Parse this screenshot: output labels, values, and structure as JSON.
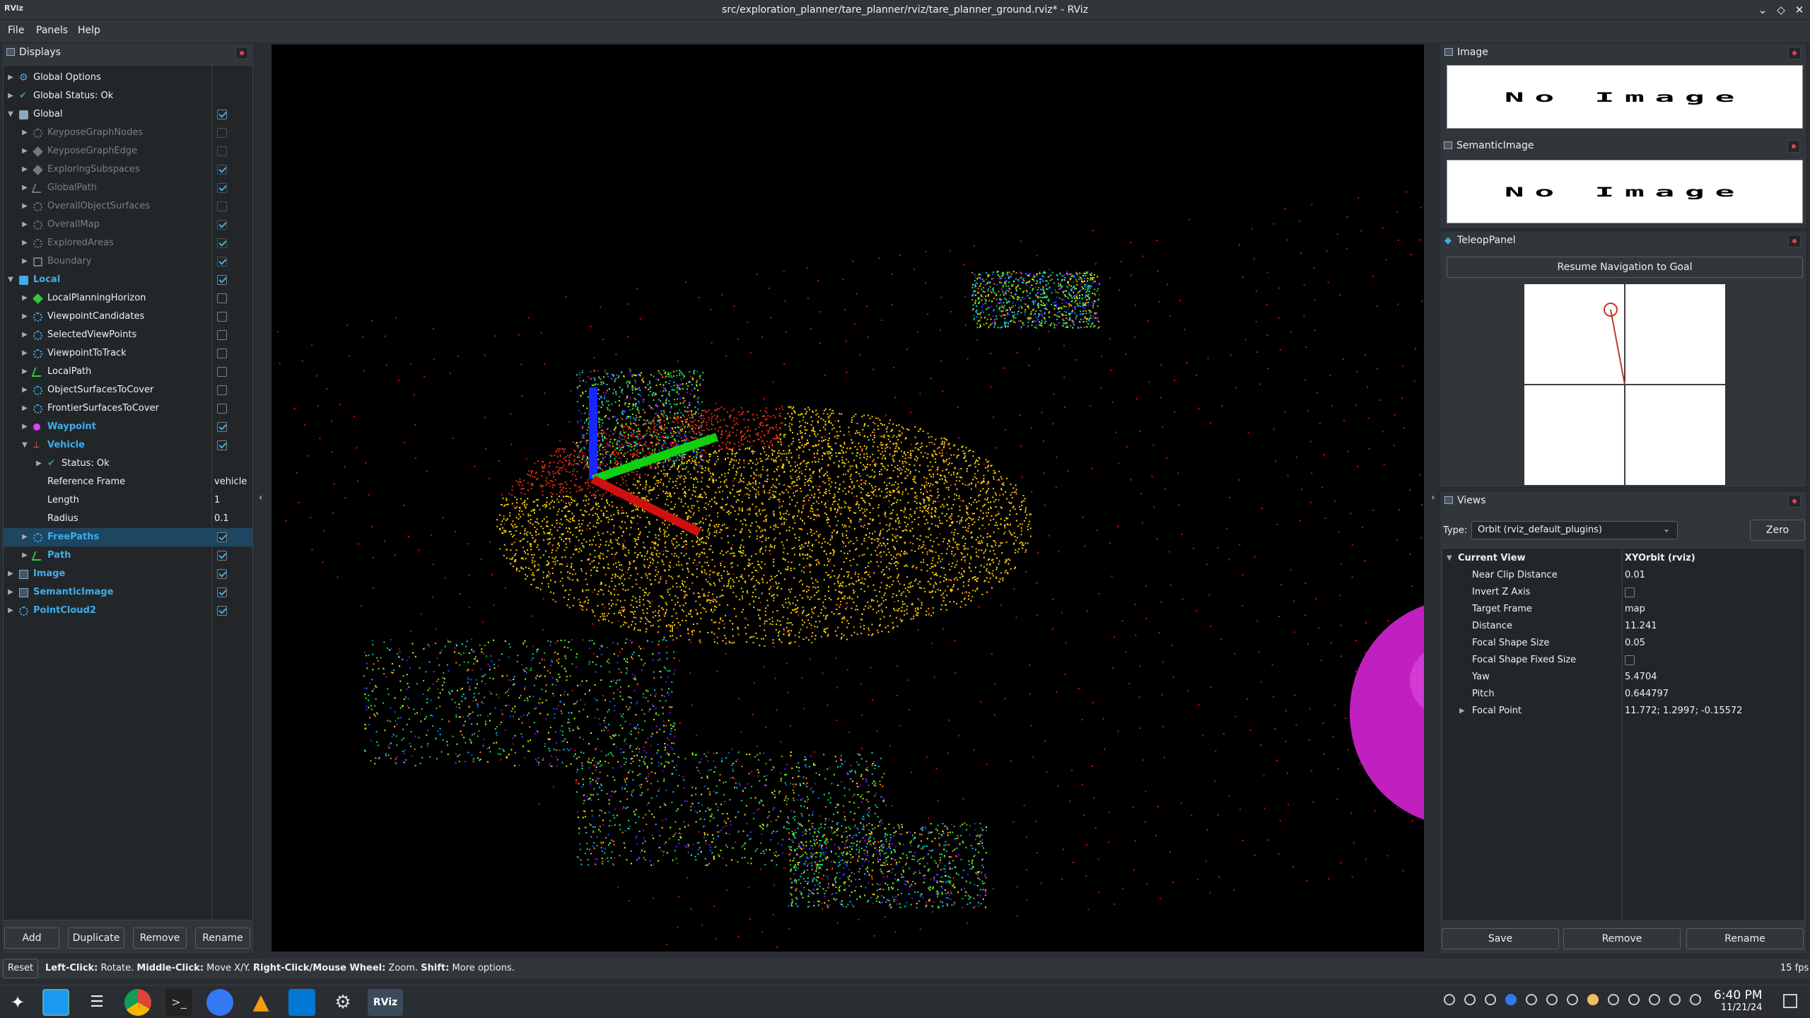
{
  "window": {
    "app_icon": "RViz",
    "title": "src/exploration_planner/tare_planner/rviz/tare_planner_ground.rviz* - RViz"
  },
  "menubar": [
    "File",
    "Panels",
    "Help"
  ],
  "displays_panel": {
    "title": "Displays",
    "items": [
      {
        "label": "Global Options"
      },
      {
        "label": "Global Status: Ok"
      },
      {
        "label": "Global"
      },
      {
        "label": "KeyposeGraphNodes"
      },
      {
        "label": "KeyposeGraphEdge"
      },
      {
        "label": "ExploringSubspaces"
      },
      {
        "label": "GlobalPath"
      },
      {
        "label": "OverallObjectSurfaces"
      },
      {
        "label": "OverallMap"
      },
      {
        "label": "ExploredAreas"
      },
      {
        "label": "Boundary"
      },
      {
        "label": "Local"
      },
      {
        "label": "LocalPlanningHorizon"
      },
      {
        "label": "ViewpointCandidates"
      },
      {
        "label": "SelectedViewPoints"
      },
      {
        "label": "ViewpointToTrack"
      },
      {
        "label": "LocalPath"
      },
      {
        "label": "ObjectSurfacesToCover"
      },
      {
        "label": "FrontierSurfacesToCover"
      },
      {
        "label": "Waypoint"
      },
      {
        "label": "Vehicle"
      },
      {
        "label": "Status: Ok"
      },
      {
        "label": "Reference Frame",
        "value": "vehicle"
      },
      {
        "label": "Length",
        "value": "1"
      },
      {
        "label": "Radius",
        "value": "0.1"
      },
      {
        "label": "FreePaths"
      },
      {
        "label": "Path"
      },
      {
        "label": "Image"
      },
      {
        "label": "SemanticImage"
      },
      {
        "label": "PointCloud2"
      }
    ],
    "buttons": [
      "Add",
      "Duplicate",
      "Remove",
      "Rename"
    ]
  },
  "image_panel": {
    "title": "Image",
    "content": "No Image"
  },
  "semantic_image_panel": {
    "title": "SemanticImage",
    "content": "No Image"
  },
  "teleop_panel": {
    "title": "TeleopPanel",
    "button": "Resume Navigation to Goal"
  },
  "views_panel": {
    "title": "Views",
    "type_label": "Type:",
    "type_value": "Orbit (rviz_default_plugins)",
    "zero_button": "Zero",
    "current_view": {
      "label": "Current View",
      "value": "XYOrbit (rviz)"
    },
    "properties": [
      {
        "label": "Near Clip Distance",
        "value": "0.01"
      },
      {
        "label": "Invert Z Axis",
        "value": ""
      },
      {
        "label": "Target Frame",
        "value": "map"
      },
      {
        "label": "Distance",
        "value": "11.241"
      },
      {
        "label": "Focal Shape Size",
        "value": "0.05"
      },
      {
        "label": "Focal Shape Fixed Size",
        "value": ""
      },
      {
        "label": "Yaw",
        "value": "5.4704"
      },
      {
        "label": "Pitch",
        "value": "0.644797"
      },
      {
        "label": "Focal Point",
        "value": "11.772; 1.2997; -0.15572"
      }
    ],
    "buttons": [
      "Save",
      "Remove",
      "Rename"
    ]
  },
  "statusbar": {
    "reset": "Reset",
    "hint_parts": [
      "Left-Click:",
      " Rotate. ",
      "Middle-Click:",
      " Move X/Y. ",
      "Right-Click/Mouse Wheel:",
      " Zoom. ",
      "Shift:",
      " More options."
    ],
    "fps": "15 fps"
  },
  "taskbar": {
    "time": "6:40 PM",
    "date": "11/21/24",
    "active_app": "RViz"
  },
  "colors": {
    "accent": "#3daee9",
    "panel_bg": "#31363b",
    "tree_bg": "#232629",
    "selected_row": "#1d4661"
  }
}
